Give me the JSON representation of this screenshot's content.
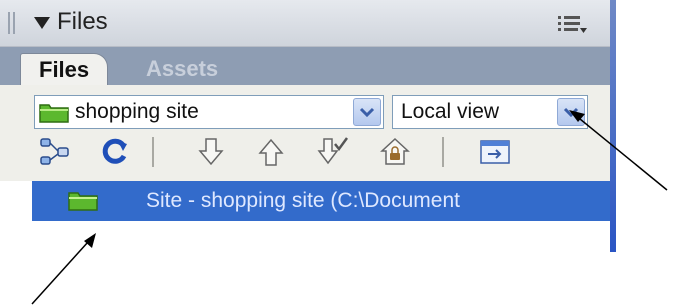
{
  "panel": {
    "title": "Files",
    "options_icon": "panel-options-icon",
    "collapse_icon": "triangle-down-icon"
  },
  "tabs": [
    {
      "label": "Files",
      "active": true
    },
    {
      "label": "Assets",
      "active": false
    }
  ],
  "site_select": {
    "value": "shopping site",
    "icon": "folder-icon"
  },
  "view_select": {
    "value": "Local view"
  },
  "toolbar_icons": [
    "connect-to-remote-host-icon",
    "refresh-icon",
    "get-files-icon",
    "put-files-icon",
    "check-out-icon",
    "check-in-icon",
    "expand-panel-icon"
  ],
  "tree": {
    "rows": [
      {
        "label": "Site - shopping site (C:\\Document",
        "selected": true,
        "icon": "folder-icon"
      }
    ]
  },
  "colors": {
    "titlebar": "#dfe3ea",
    "tabstrip": "#8e9db3",
    "selection": "#336bcb",
    "folder": "#5cb82e",
    "refresh": "#1f4fb8",
    "arrow": "#000000"
  }
}
